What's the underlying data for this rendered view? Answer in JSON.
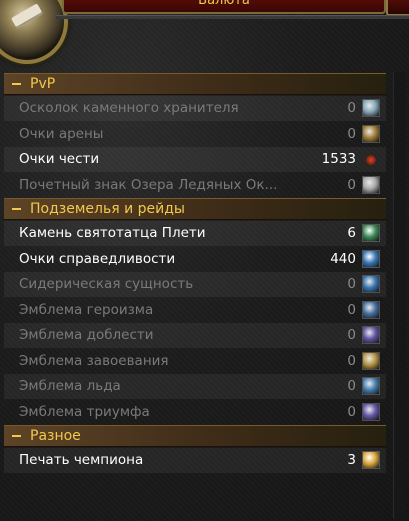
{
  "window": {
    "title": "Валюта"
  },
  "sections": [
    {
      "label": "PvP",
      "items": [
        {
          "name": "Осколок каменного хранителя",
          "count": "0",
          "active": false,
          "icon": "stone-shard-icon",
          "color": "#8fb6c8"
        },
        {
          "name": "Очки арены",
          "count": "0",
          "active": false,
          "icon": "arena-points-icon",
          "color": "#b08a3a"
        },
        {
          "name": "Очки чести",
          "count": "1533",
          "active": true,
          "icon": "honor-points-icon",
          "color": "#9c2a1a"
        },
        {
          "name": "Почетный знак Озера Ледяных Ок...",
          "count": "0",
          "active": false,
          "icon": "wintergrasp-mark-icon",
          "color": "#b9b9b9"
        }
      ]
    },
    {
      "label": "Подземелья и рейды",
      "items": [
        {
          "name": "Камень святотатца Плети",
          "count": "6",
          "active": true,
          "icon": "defiler-scourgestone-icon",
          "color": "#3f8c5a"
        },
        {
          "name": "Очки справедливости",
          "count": "440",
          "active": true,
          "icon": "justice-points-icon",
          "color": "#3a79b8"
        },
        {
          "name": "Сидерическая сущность",
          "count": "0",
          "active": false,
          "icon": "sidereal-essence-icon",
          "color": "#3a7fbf"
        },
        {
          "name": "Эмблема героизма",
          "count": "0",
          "active": false,
          "icon": "emblem-of-heroism-icon",
          "color": "#4a78b0"
        },
        {
          "name": "Эмблема доблести",
          "count": "0",
          "active": false,
          "icon": "emblem-of-valor-icon",
          "color": "#6a5ab0"
        },
        {
          "name": "Эмблема завоевания",
          "count": "0",
          "active": false,
          "icon": "emblem-of-conquest-icon",
          "color": "#c9a24a"
        },
        {
          "name": "Эмблема льда",
          "count": "0",
          "active": false,
          "icon": "emblem-of-frost-icon",
          "color": "#4a8ac0"
        },
        {
          "name": "Эмблема триумфа",
          "count": "0",
          "active": false,
          "icon": "emblem-of-triumph-icon",
          "color": "#6f5fb8"
        }
      ]
    },
    {
      "label": "Разное",
      "items": [
        {
          "name": "Печать чемпиона",
          "count": "3",
          "active": true,
          "icon": "champions-seal-icon",
          "color": "#d9a63a"
        }
      ]
    }
  ]
}
